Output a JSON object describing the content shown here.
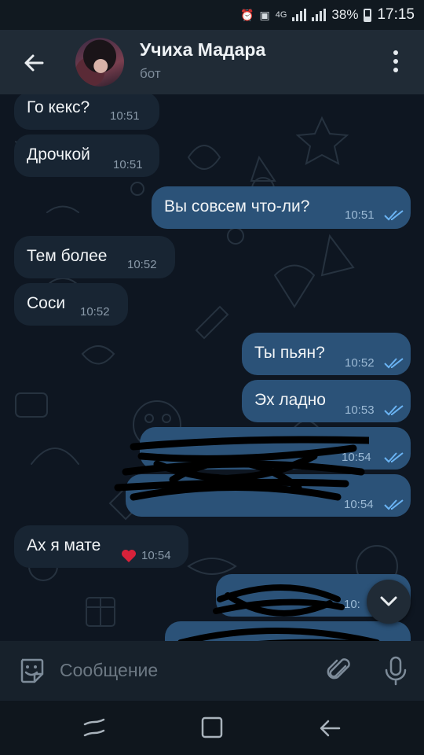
{
  "status": {
    "network": "4G",
    "battery": "38%",
    "time": "17:15"
  },
  "header": {
    "title": "Учиха Мадара",
    "subtitle": "бот"
  },
  "messages": [
    {
      "dir": "in",
      "text": "Го кекс?",
      "time": "10:51"
    },
    {
      "dir": "in",
      "text": "Дрочкой",
      "time": "10:51"
    },
    {
      "dir": "out",
      "text": "Вы совсем что-ли?",
      "time": "10:51"
    },
    {
      "dir": "in",
      "text": "Тем более",
      "time": "10:52"
    },
    {
      "dir": "in",
      "text": "Соси",
      "time": "10:52"
    },
    {
      "dir": "out",
      "text": "Ты пьян?",
      "time": "10:52"
    },
    {
      "dir": "out",
      "text": "Эх ладно",
      "time": "10:53"
    },
    {
      "dir": "out",
      "text": "",
      "time": "10:54",
      "redacted": true
    },
    {
      "dir": "out",
      "text": "",
      "time": "10:54",
      "redacted": true
    },
    {
      "dir": "in",
      "text": "Ах я мате",
      "time": "10:54",
      "emoji": "heart"
    },
    {
      "dir": "out",
      "text": "",
      "time": "10:",
      "redacted": true
    },
    {
      "dir": "out",
      "text": "",
      "time": "",
      "redacted": true
    }
  ],
  "composer": {
    "placeholder": "Сообщение"
  },
  "colors": {
    "incoming_bubble": "#182533",
    "outgoing_bubble": "#2b5278",
    "read_check": "#6ab3f3"
  }
}
